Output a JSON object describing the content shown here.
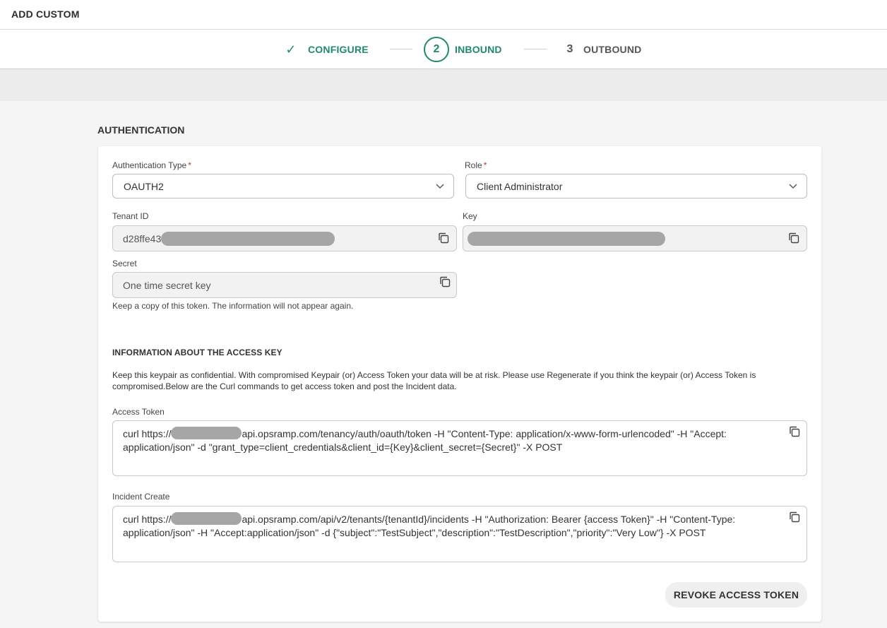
{
  "header": {
    "title": "ADD CUSTOM"
  },
  "stepper": {
    "steps": [
      {
        "label": "CONFIGURE",
        "status": "completed",
        "icon": "check-icon"
      },
      {
        "number": "2",
        "label": "INBOUND",
        "status": "active"
      },
      {
        "number": "3",
        "label": "OUTBOUND",
        "status": "pending"
      }
    ]
  },
  "section": {
    "title": "AUTHENTICATION"
  },
  "form": {
    "auth_type": {
      "label": "Authentication Type",
      "required": "*",
      "value": "OAUTH2"
    },
    "role": {
      "label": "Role",
      "required": "*",
      "value": "Client Administrator"
    },
    "tenant_id": {
      "label": "Tenant ID",
      "value": "d28ffe43"
    },
    "key": {
      "label": "Key",
      "value": ""
    },
    "secret": {
      "label": "Secret",
      "placeholder": "One time secret key"
    },
    "secret_hint": "Keep a copy of this token. The information will not appear again."
  },
  "info": {
    "title": "INFORMATION ABOUT THE ACCESS KEY",
    "text": "Keep this keypair as confidential. With compromised Keypair (or) Access Token your data will be at risk. Please use Regenerate if you think the keypair (or) Access Token is compromised.Below are the Curl commands to get access token and post the Incident data."
  },
  "access_token": {
    "label": "Access Token",
    "prefix": "curl https://",
    "suffix": "api.opsramp.com/tenancy/auth/oauth/token -H \"Content-Type: application/x-www-form-urlencoded\" -H \"Accept: application/json\" -d \"grant_type=client_credentials&client_id={Key}&client_secret={Secret}\" -X POST"
  },
  "incident_create": {
    "label": "Incident Create",
    "prefix": "curl https://",
    "suffix": "api.opsramp.com/api/v2/tenants/{tenantId}/incidents -H \"Authorization: Bearer {access Token}\" -H \"Content-Type: application/json\" -H \"Accept:application/json\" -d {\"subject\":\"TestSubject\",\"description\":\"TestDescription\",\"priority\":\"Very Low\"} -X POST"
  },
  "actions": {
    "revoke_label": "REVOKE ACCESS TOKEN"
  },
  "colors": {
    "accent": "#1f8a6c",
    "required": "#d0312d",
    "redaction": "#a6a6a6"
  }
}
